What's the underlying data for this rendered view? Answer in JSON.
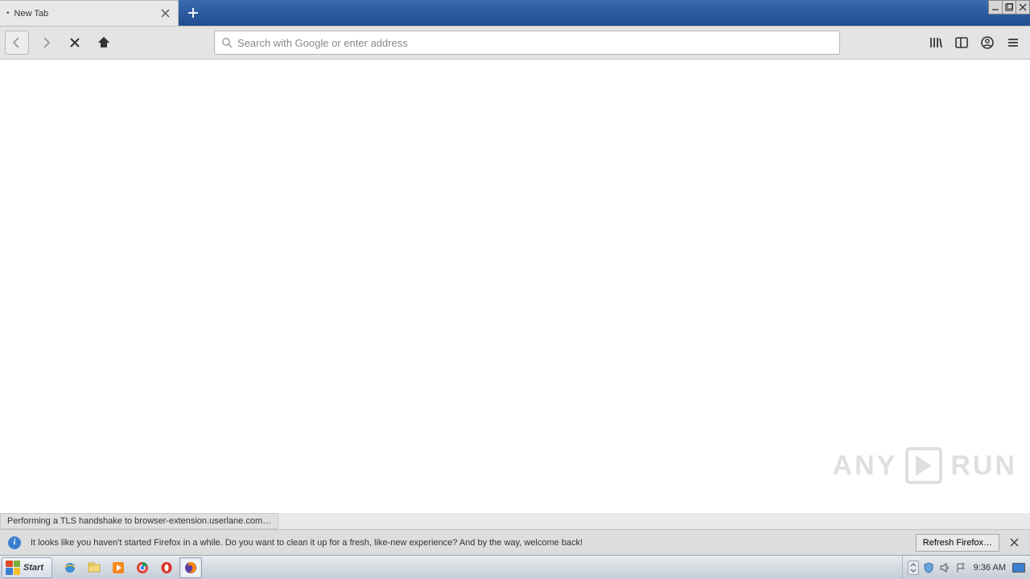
{
  "tab": {
    "title": "New Tab"
  },
  "address": {
    "placeholder": "Search with Google or enter address"
  },
  "status": {
    "text": "Performing a TLS handshake to browser-extension.userlane.com…"
  },
  "infobar": {
    "message": "It looks like you haven't started Firefox in a while. Do you want to clean it up for a fresh, like-new experience? And by the way, welcome back!",
    "button": "Refresh Firefox…"
  },
  "taskbar": {
    "start": "Start",
    "clock": "9:36 AM"
  },
  "watermark": {
    "left": "ANY",
    "right": "RUN"
  }
}
